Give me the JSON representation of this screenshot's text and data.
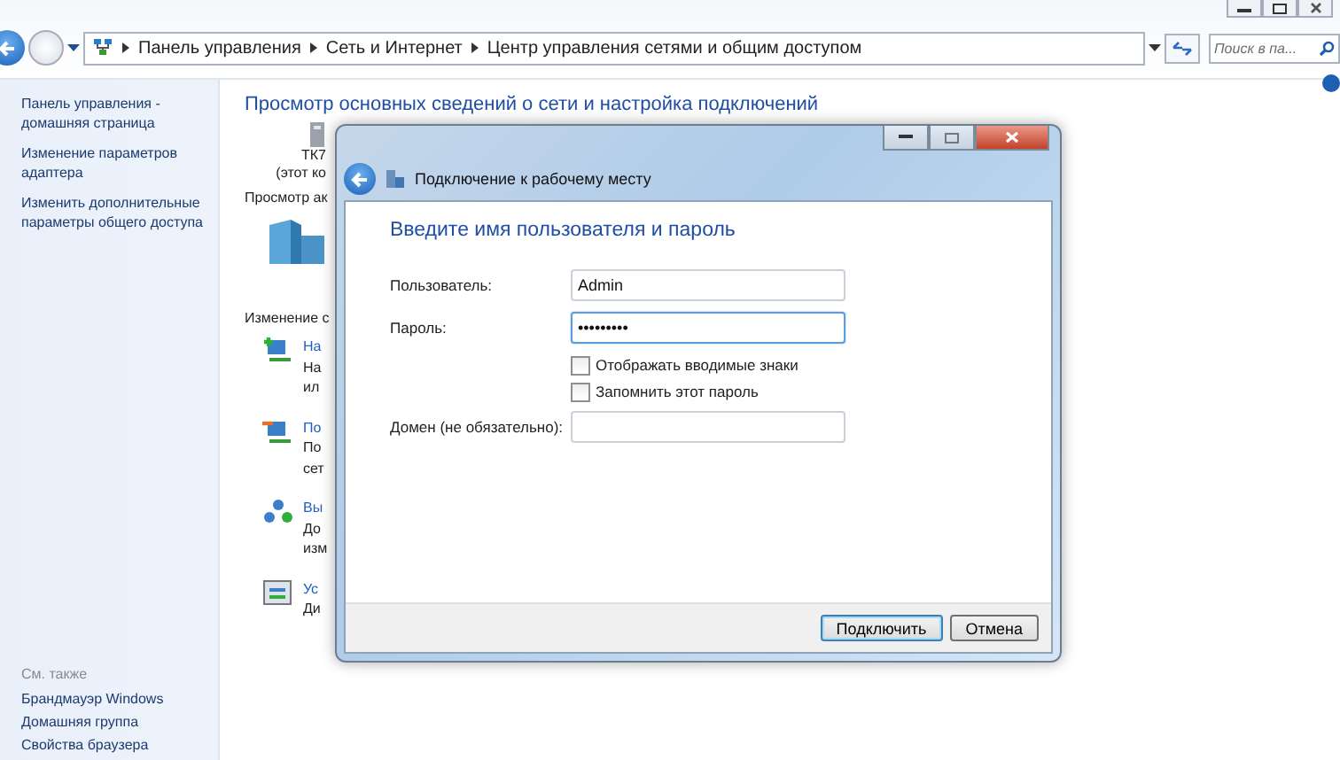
{
  "window": {
    "breadcrumb": [
      "Панель управления",
      "Сеть и Интернет",
      "Центр управления сетями и общим доступом"
    ],
    "search": {
      "placeholder": "Поиск в па..."
    }
  },
  "sidebar": {
    "links": [
      {
        "label": "Панель управления - домашняя страница"
      },
      {
        "label": "Изменение параметров адаптера"
      },
      {
        "label": "Изменить дополнительные параметры общего доступа"
      }
    ],
    "see_also_title": "См. также",
    "see_also": [
      {
        "label": "Брандмауэр Windows"
      },
      {
        "label": "Домашняя группа"
      },
      {
        "label": "Свойства браузера"
      }
    ]
  },
  "main": {
    "title": "Просмотр основных сведений о сети и настройка подключений",
    "computer": [
      "ТК7",
      "(этот ко"
    ],
    "section_1": "Просмотр ак",
    "section_2": "Изменение с",
    "tasks": [
      {
        "kind": "setup",
        "title": "На",
        "lines": [
          "На",
          "ил"
        ]
      },
      {
        "kind": "connect",
        "title": "По",
        "lines": [
          "По",
          "сет"
        ]
      },
      {
        "kind": "homegroup",
        "title": "Вы",
        "lines": [
          "До",
          "изм"
        ]
      },
      {
        "kind": "troubleshoot",
        "title": "Ус",
        "lines": [
          "Ди"
        ]
      }
    ]
  },
  "dialog": {
    "title": "Подключение к рабочему месту",
    "heading": "Введите имя пользователя и пароль",
    "fields": [
      {
        "label": "Пользователь:",
        "value": "Admin",
        "focused": false
      },
      {
        "label": "Пароль:",
        "value": "•••••••••",
        "focused": true
      }
    ],
    "checkboxes": [
      {
        "label": "Отображать вводимые знаки",
        "checked": false
      },
      {
        "label": "Запомнить этот пароль",
        "checked": false
      }
    ],
    "domain": {
      "label": "Домен (не обязательно):"
    },
    "buttons": [
      {
        "label": "Подключить",
        "default": true
      },
      {
        "label": "Отмена",
        "default": false
      }
    ]
  }
}
